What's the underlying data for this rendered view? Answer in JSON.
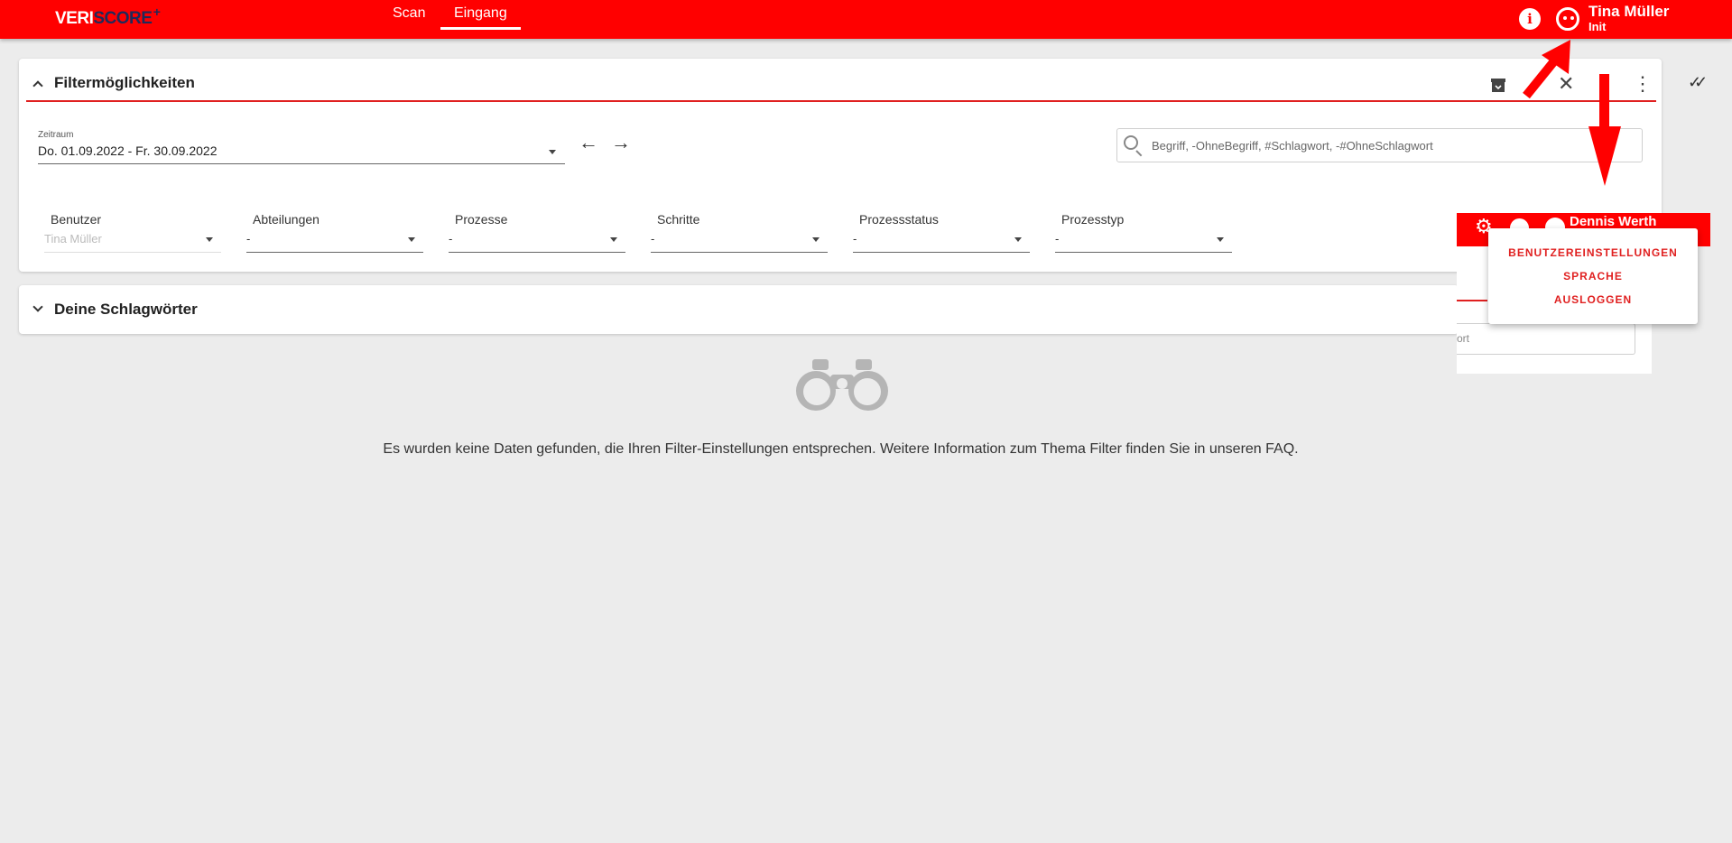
{
  "app": {
    "logo": {
      "part1": "VERI",
      "part2": "SCORE",
      "plus": "+"
    },
    "colors": {
      "primary": "#ff0000",
      "logo_dark": "#1f2a5a",
      "background": "#ececec"
    }
  },
  "header": {
    "tabs": [
      {
        "label": "Scan",
        "active": false
      },
      {
        "label": "Eingang",
        "active": true
      }
    ],
    "info_icon": "info-icon",
    "avatar_icon": "avatar-icon",
    "user_name": "Tina Müller",
    "user_role": "Init"
  },
  "filter_panel": {
    "title": "Filtermöglichkeiten",
    "toolbar_icons": [
      "archive-icon",
      "close-icon",
      "more-vert-icon"
    ],
    "zeitraum": {
      "label": "Zeitraum",
      "value": "Do. 01.09.2022 - Fr. 30.09.2022"
    },
    "search": {
      "placeholder": "Begriff, -OhneBegriff, #Schlagwort, -#OhneSchlagwort"
    },
    "dropdowns": [
      {
        "label": "Benutzer",
        "value": "Tina Müller",
        "placeholder": true
      },
      {
        "label": "Abteilungen",
        "value": "-"
      },
      {
        "label": "Prozesse",
        "value": "-"
      },
      {
        "label": "Schritte",
        "value": "-"
      },
      {
        "label": "Prozessstatus",
        "value": "-"
      },
      {
        "label": "Prozesstyp",
        "value": "-"
      }
    ]
  },
  "tags_panel": {
    "title": "Deine Schlagwörter"
  },
  "empty_state": {
    "icon": "binoculars-icon",
    "message": "Es wurden keine Daten gefunden, die Ihren Filter-Einstellungen entsprechen. Weitere Information zum Thema Filter finden Sie in unseren FAQ."
  },
  "overlay": {
    "user_name": "Dennis Werth",
    "input_fragment": "ort",
    "icons": [
      "gear-icon",
      "info-icon",
      "avatar-icon"
    ]
  },
  "user_menu": {
    "items": [
      "BENUTZEREINSTELLUNGEN",
      "SPRACHE",
      "AUSLOGGEN"
    ]
  }
}
